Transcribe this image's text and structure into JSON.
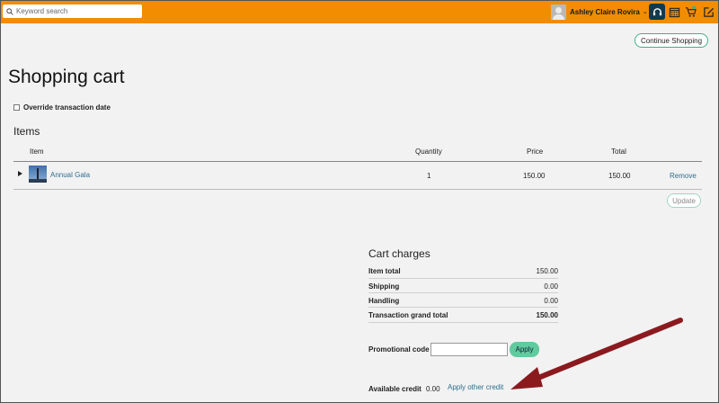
{
  "topbar": {
    "search": {
      "placeholder": "Keyword search",
      "value": ""
    },
    "user": {
      "name": "Ashley Claire Rovira"
    },
    "accent": "#f28c00"
  },
  "page": {
    "continue_label": "Continue Shopping",
    "title": "Shopping cart",
    "override_label": "Override transaction date",
    "items_heading": "Items"
  },
  "table": {
    "headers": {
      "item": "Item",
      "quantity": "Quantity",
      "price": "Price",
      "total": "Total"
    },
    "rows": [
      {
        "name": "Annual Gala",
        "quantity": "1",
        "price": "150.00",
        "total": "150.00",
        "action": "Remove"
      }
    ],
    "update_label": "Update"
  },
  "charges": {
    "title": "Cart charges",
    "rows": [
      {
        "label": "Item total",
        "value": "150.00"
      },
      {
        "label": "Shipping",
        "value": "0.00"
      },
      {
        "label": "Handling",
        "value": "0.00"
      },
      {
        "label": "Transaction grand total",
        "value": "150.00"
      }
    ],
    "promo_label": "Promotional code",
    "promo_value": "",
    "apply_label": "Apply",
    "credit_label": "Available credit",
    "credit_value": "0.00",
    "credit_link": "Apply other credit"
  },
  "icons": [
    "search-icon",
    "headset-icon",
    "calendar-icon",
    "cart-icon",
    "edit-icon",
    "expand-triangle-icon",
    "annotation-arrow"
  ],
  "colors": {
    "link": "#2e6e8e",
    "button_green": "#5fcb9e",
    "arrow": "#8b1a1f"
  }
}
